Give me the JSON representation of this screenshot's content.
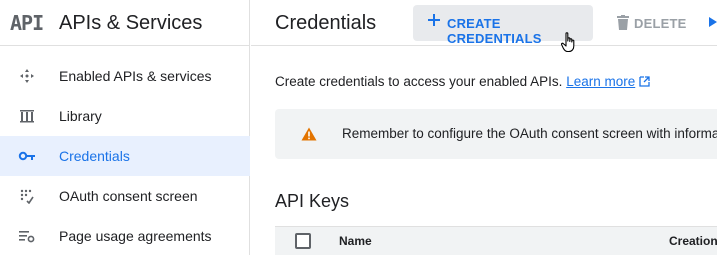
{
  "sidebar": {
    "logo": "API",
    "title": "APIs & Services",
    "items": [
      {
        "label": "Enabled APIs & services",
        "icon": "enabled-apis-icon",
        "active": false
      },
      {
        "label": "Library",
        "icon": "library-icon",
        "active": false
      },
      {
        "label": "Credentials",
        "icon": "key-icon",
        "active": true
      },
      {
        "label": "OAuth consent screen",
        "icon": "oauth-consent-icon",
        "active": false
      },
      {
        "label": "Page usage agreements",
        "icon": "settings-list-icon",
        "active": false
      }
    ]
  },
  "header": {
    "title": "Credentials",
    "create_label": "CREATE CREDENTIALS",
    "delete_label": "DELETE"
  },
  "main": {
    "description": "Create credentials to access your enabled APIs.",
    "learn_more": "Learn more",
    "warning": "Remember to configure the OAuth consent screen with informatio",
    "api_keys_title": "API Keys",
    "table": {
      "columns": [
        "Name",
        "Creation"
      ]
    }
  },
  "colors": {
    "accent": "#1a73e8",
    "active_bg": "#e8f0fe",
    "warning": "#e37400",
    "muted": "#9aa0a6"
  }
}
